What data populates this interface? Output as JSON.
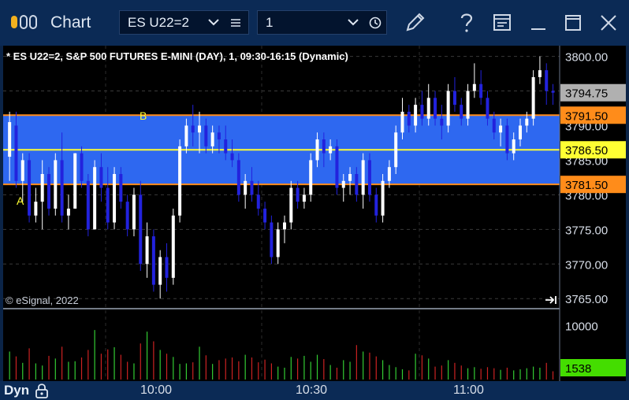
{
  "window": {
    "title": "Chart",
    "symbol": "ES U22=2",
    "interval": "1"
  },
  "chart": {
    "header": "* ES U22=2, S&P 500 FUTURES E-MINI (DAY), 1, 09:30-16:15 (Dynamic)",
    "copyright": "© eSignal, 2022",
    "label_a": "A",
    "label_b": "B",
    "price_ticks": [
      "3800.00",
      "3795.00",
      "3790.00",
      "3785.00",
      "3780.00",
      "3775.00",
      "3770.00",
      "3765.00"
    ],
    "tags": {
      "last": "3794.75",
      "upper": "3791.50",
      "mid": "3786.50",
      "lower": "3781.50"
    },
    "volume_tick": "10000",
    "volume_last": "1538",
    "colors": {
      "band": "#2e68f0",
      "boundary": "#ff8c1a",
      "midline": "#ffff33",
      "up_bar": "#ffffff",
      "down_bar": "#2222dd",
      "volume_up": "#33cc33",
      "volume_down": "#cc2222",
      "last_tag": "#b0b0b0",
      "volume_tag": "#44dd00"
    }
  },
  "chart_data": {
    "type": "candlestick",
    "price_range": [
      3764,
      3802
    ],
    "price_levels": {
      "upper": 3791.5,
      "mid": 3786.5,
      "lower": 3781.5,
      "last": 3794.75
    },
    "candles_ohlc": [
      [
        3785.5,
        3792,
        3782,
        3790.5
      ],
      [
        3790,
        3792,
        3781,
        3782
      ],
      [
        3782,
        3786,
        3779,
        3785
      ],
      [
        3785,
        3786,
        3776,
        3777
      ],
      [
        3777,
        3781,
        3776,
        3779
      ],
      [
        3779,
        3785,
        3775,
        3783
      ],
      [
        3783,
        3784,
        3777,
        3778
      ],
      [
        3778,
        3786,
        3777,
        3785
      ],
      [
        3785,
        3789,
        3776,
        3777
      ],
      [
        3777,
        3780,
        3775,
        3778
      ],
      [
        3778,
        3786,
        3778,
        3786
      ],
      [
        3786,
        3787,
        3781,
        3782
      ],
      [
        3782,
        3783,
        3774,
        3775
      ],
      [
        3775,
        3785,
        3775,
        3784
      ],
      [
        3784,
        3786,
        3779,
        3781
      ],
      [
        3781,
        3784,
        3775,
        3776
      ],
      [
        3776,
        3784,
        3775,
        3783
      ],
      [
        3783,
        3784,
        3778,
        3779
      ],
      [
        3779,
        3780,
        3774,
        3775
      ],
      [
        3775,
        3781,
        3774,
        3780
      ],
      [
        3780,
        3782,
        3769,
        3770
      ],
      [
        3770,
        3776,
        3768,
        3774
      ],
      [
        3774,
        3775,
        3766,
        3767
      ],
      [
        3767,
        3772,
        3765,
        3771
      ],
      [
        3771,
        3773,
        3766,
        3768
      ],
      [
        3768,
        3778,
        3767,
        3777
      ],
      [
        3777,
        3788,
        3776,
        3787
      ],
      [
        3787,
        3791,
        3786,
        3790
      ],
      [
        3790,
        3793,
        3787,
        3789
      ],
      [
        3789,
        3792,
        3786,
        3790
      ],
      [
        3790,
        3791,
        3786,
        3787
      ],
      [
        3787,
        3790,
        3786,
        3789
      ],
      [
        3789,
        3790,
        3786,
        3788
      ],
      [
        3788,
        3790,
        3785,
        3786
      ],
      [
        3786,
        3788,
        3784,
        3785
      ],
      [
        3785,
        3786,
        3779,
        3780
      ],
      [
        3780,
        3783,
        3778,
        3782
      ],
      [
        3782,
        3784,
        3779,
        3780
      ],
      [
        3780,
        3782,
        3777,
        3778
      ],
      [
        3778,
        3779,
        3775,
        3776
      ],
      [
        3776,
        3777,
        3770,
        3771
      ],
      [
        3771,
        3776,
        3770,
        3775
      ],
      [
        3775,
        3777,
        3773,
        3776
      ],
      [
        3776,
        3782,
        3775,
        3781
      ],
      [
        3781,
        3782,
        3778,
        3779
      ],
      [
        3779,
        3781,
        3778,
        3780
      ],
      [
        3780,
        3786,
        3779,
        3785
      ],
      [
        3785,
        3789,
        3784,
        3788
      ],
      [
        3788,
        3789,
        3784,
        3786
      ],
      [
        3786,
        3788,
        3785,
        3787
      ],
      [
        3787,
        3788,
        3780,
        3781
      ],
      [
        3781,
        3783,
        3779,
        3782
      ],
      [
        3782,
        3784,
        3780,
        3783
      ],
      [
        3783,
        3784,
        3779,
        3780
      ],
      [
        3780,
        3786,
        3778,
        3785
      ],
      [
        3785,
        3786,
        3779,
        3780
      ],
      [
        3780,
        3781,
        3776,
        3777
      ],
      [
        3777,
        3783,
        3776,
        3782
      ],
      [
        3782,
        3785,
        3781,
        3784
      ],
      [
        3784,
        3790,
        3783,
        3789
      ],
      [
        3789,
        3794,
        3788,
        3792
      ],
      [
        3792,
        3793,
        3789,
        3790
      ],
      [
        3790,
        3794,
        3789,
        3793
      ],
      [
        3793,
        3795,
        3790,
        3791
      ],
      [
        3791,
        3796,
        3790,
        3794
      ],
      [
        3794,
        3795,
        3790,
        3791
      ],
      [
        3791,
        3793,
        3788,
        3790
      ],
      [
        3790,
        3796,
        3789,
        3795
      ],
      [
        3795,
        3797,
        3792,
        3793
      ],
      [
        3793,
        3794,
        3790,
        3791
      ],
      [
        3791,
        3796,
        3790,
        3795
      ],
      [
        3795,
        3799,
        3794,
        3796
      ],
      [
        3796,
        3798,
        3793,
        3794
      ],
      [
        3794,
        3795,
        3790,
        3791
      ],
      [
        3791,
        3792,
        3788,
        3789
      ],
      [
        3789,
        3791,
        3787,
        3790
      ],
      [
        3790,
        3791,
        3785,
        3786
      ],
      [
        3786,
        3789,
        3785,
        3788
      ],
      [
        3788,
        3791,
        3787,
        3790
      ],
      [
        3790,
        3792,
        3789,
        3791
      ],
      [
        3791,
        3798,
        3790,
        3797
      ],
      [
        3797,
        3800,
        3796,
        3798
      ],
      [
        3798,
        3799,
        3793,
        3795
      ],
      [
        3795,
        3796,
        3793,
        3794.75
      ]
    ],
    "volume_range": [
      0,
      12000
    ],
    "volume_up": [
      true,
      false,
      true,
      false,
      true,
      true,
      false,
      true,
      false,
      true,
      true,
      false,
      false,
      true,
      false,
      false,
      true,
      false,
      false,
      true,
      false,
      true,
      false,
      true,
      false,
      true,
      true,
      true,
      false,
      true,
      false,
      true,
      false,
      false,
      false,
      false,
      true,
      false,
      false,
      false,
      false,
      true,
      true,
      true,
      false,
      true,
      true,
      true,
      false,
      true,
      false,
      true,
      true,
      false,
      true,
      false,
      false,
      true,
      true,
      true,
      true,
      false,
      true,
      false,
      true,
      false,
      false,
      true,
      false,
      false,
      true,
      true,
      false,
      false,
      false,
      true,
      false,
      true,
      true,
      true,
      true,
      true,
      false,
      false
    ],
    "volume": [
      5200,
      4300,
      3100,
      5800,
      3000,
      2600,
      4400,
      3900,
      6100,
      3300,
      3400,
      4100,
      5500,
      9200,
      4800,
      5600,
      6000,
      4600,
      3300,
      3000,
      6700,
      8900,
      7100,
      5500,
      4800,
      4200,
      2900,
      3000,
      3200,
      6100,
      4500,
      2900,
      3600,
      3900,
      4100,
      3400,
      4600,
      4100,
      3200,
      3700,
      3000,
      2400,
      2200,
      4200,
      3900,
      4400,
      3300,
      4600,
      3800,
      2700,
      2200,
      3600,
      3300,
      6400,
      5200,
      5000,
      4300,
      3600,
      2700,
      2300,
      1900,
      1700,
      4800,
      4500,
      3900,
      2400,
      2600,
      3600,
      3100,
      2600,
      2100,
      2300,
      2000,
      2300,
      2100,
      1800,
      2200,
      1700,
      1900,
      2100,
      2400,
      2200,
      3100,
      1538
    ],
    "x_tick_labels": [
      "10:00",
      "10:30",
      "11:00"
    ]
  }
}
